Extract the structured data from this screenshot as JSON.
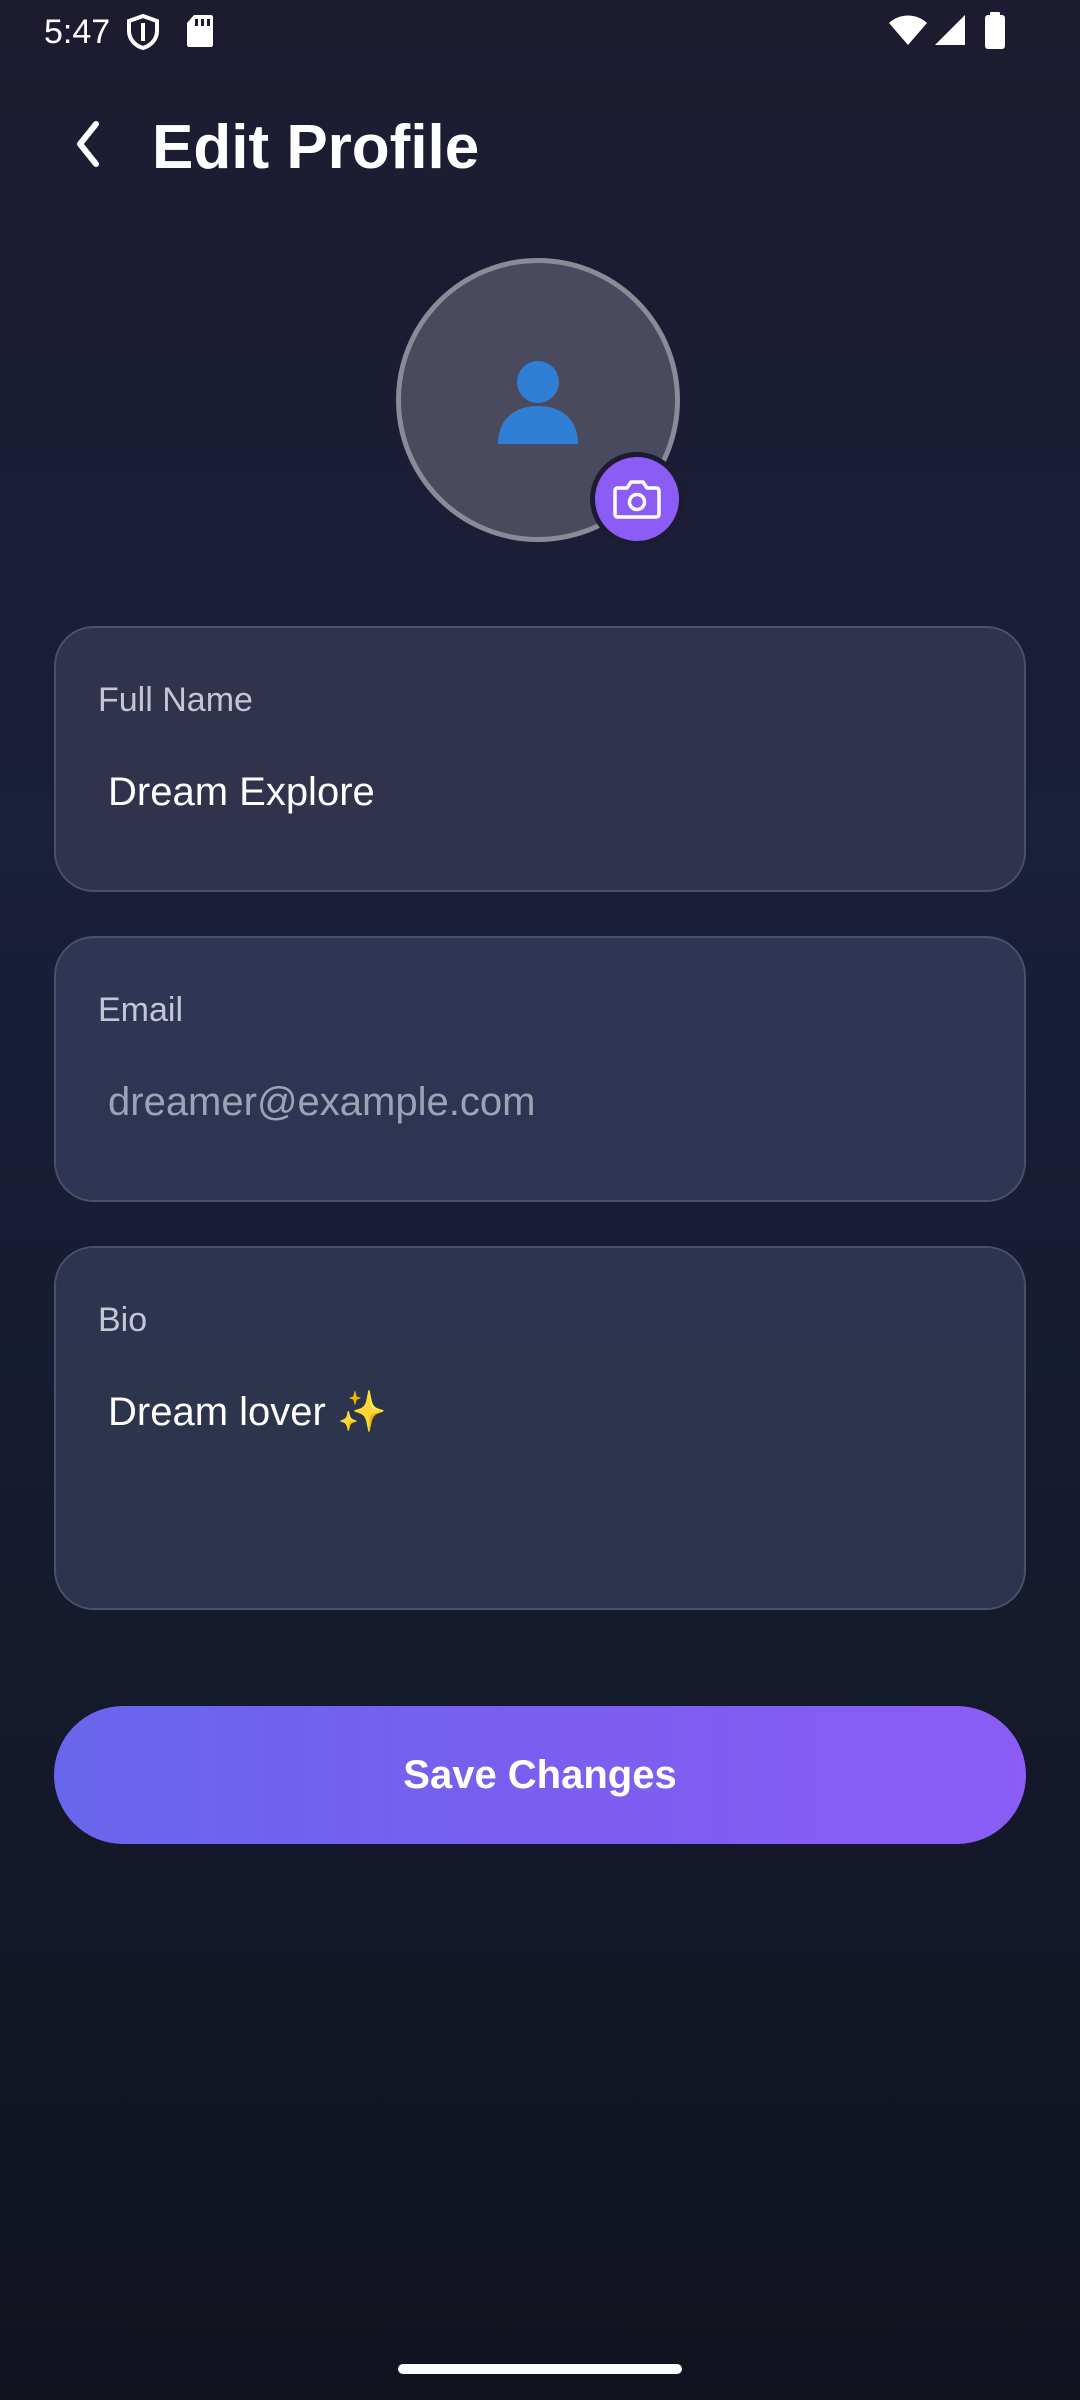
{
  "status_bar": {
    "time": "5:47"
  },
  "header": {
    "title": "Edit Profile"
  },
  "avatar": {
    "glyph": "👤"
  },
  "fields": {
    "full_name": {
      "label": "Full Name",
      "value": "Dream Explore"
    },
    "email": {
      "label": "Email",
      "placeholder": "dreamer@example.com"
    },
    "bio": {
      "label": "Bio",
      "value": "Dream lover ✨"
    }
  },
  "actions": {
    "save_label": "Save Changes"
  },
  "colors": {
    "accent": "#8b5cf6",
    "accent_start": "#6866ec",
    "background_top": "#1c1b30",
    "background_bottom": "#11141f"
  },
  "icons": {
    "back": "chevron-left-icon",
    "camera": "camera-icon",
    "avatar": "user-icon",
    "shield": "shield-icon",
    "sd_card": "sd-card-icon",
    "wifi": "wifi-icon",
    "signal": "signal-icon",
    "battery": "battery-icon"
  }
}
